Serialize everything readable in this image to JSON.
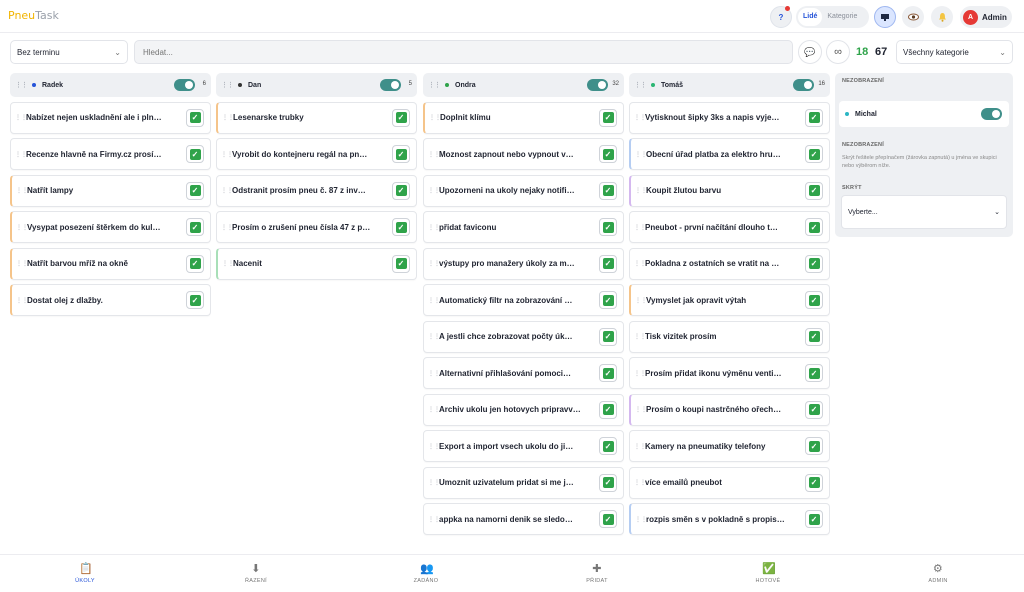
{
  "app": {
    "logo_a": "Pneu",
    "logo_b": "Task"
  },
  "header": {
    "help": "?",
    "seg": [
      "Lidé",
      "Kategorie"
    ],
    "user_initial": "A",
    "user_name": "Admin"
  },
  "toolbar": {
    "deadline": "Bez terminu",
    "search_placeholder": "Hledat...",
    "inf": "∞",
    "count_green": "18",
    "count_total": "67",
    "category": "Všechny kategorie"
  },
  "columns": [
    {
      "name": "Radek",
      "dot": "#2553d8",
      "count": "6",
      "cards": [
        {
          "t": "Nabízet nejen uskladnění ale i pln…",
          "b": "bl-n"
        },
        {
          "t": "Recenze hlavně na Firmy.cz prosí…",
          "b": "bl-n"
        },
        {
          "t": "Natřít lampy",
          "b": "bl-o"
        },
        {
          "t": "Vysypat posezení štěrkem do kul…",
          "b": "bl-o"
        },
        {
          "t": "Natřít barvou mříž na okně",
          "b": "bl-o"
        },
        {
          "t": "Dostat olej z dlažby.",
          "b": "bl-o"
        }
      ]
    },
    {
      "name": "Dan",
      "dot": "#333333",
      "count": "5",
      "cards": [
        {
          "t": "Lesenarske trubky",
          "b": "bl-o"
        },
        {
          "t": "Vyrobit do kontejneru regál na pn…",
          "b": "bl-n"
        },
        {
          "t": "Odstranit prosím pneu č. 87 z inv…",
          "b": "bl-n"
        },
        {
          "t": "Prosím o zrušení pneu čísla 47 z p…",
          "b": "bl-n"
        },
        {
          "t": "Nacenit",
          "b": "bl-g"
        }
      ]
    },
    {
      "name": "Ondra",
      "dot": "#2fa34a",
      "count": "32",
      "cards": [
        {
          "t": "Doplnit klímu",
          "b": "bl-o"
        },
        {
          "t": "Moznost zapnout nebo vypnout v…",
          "b": "bl-n"
        },
        {
          "t": "Upozorneni na ukoly nejaky notifi…",
          "b": "bl-n"
        },
        {
          "t": "přidat faviconu",
          "b": "bl-n"
        },
        {
          "t": "výstupy pro manažery úkoly za m…",
          "b": "bl-n"
        },
        {
          "t": "Automatický filtr na zobrazování …",
          "b": "bl-n"
        },
        {
          "t": "A jestli chce zobrazovat počty úk…",
          "b": "bl-n"
        },
        {
          "t": "Alternativní přihlašování pomoci…",
          "b": "bl-n"
        },
        {
          "t": "Archiv ukolu jen hotovych pripravv…",
          "b": "bl-n"
        },
        {
          "t": "Export a import vsech ukolu do ji…",
          "b": "bl-n"
        },
        {
          "t": "Umoznit uzivatelum pridat si me j…",
          "b": "bl-n"
        },
        {
          "t": "appka na namorni denik se sledo…",
          "b": "bl-n"
        }
      ]
    },
    {
      "name": "Tomáš",
      "dot": "#2bb673",
      "count": "16",
      "cards": [
        {
          "t": "Vytisknout šipky 3ks a napis vyje…",
          "b": "bl-n"
        },
        {
          "t": "Obecní úřad platba za elektro hru…",
          "b": "bl-b"
        },
        {
          "t": "Koupit žlutou barvu",
          "b": "bl-p"
        },
        {
          "t": "Pneubot - první načítání dlouho t…",
          "b": "bl-n"
        },
        {
          "t": "Pokladna z ostatních se vratit na …",
          "b": "bl-n"
        },
        {
          "t": "Vymyslet jak opravit výtah",
          "b": "bl-o"
        },
        {
          "t": "Tisk vizitek prosím",
          "b": "bl-n"
        },
        {
          "t": "Prosím přidat ikonu výměnu venti…",
          "b": "bl-n"
        },
        {
          "t": "Prosím o koupi nastrčného ořech…",
          "b": "bl-p"
        },
        {
          "t": "Kamery na pneumatiky telefony",
          "b": "bl-n"
        },
        {
          "t": "více emailů pneubot",
          "b": "bl-n"
        },
        {
          "t": "rozpis směn s v pokladně s propis…",
          "b": "bl-b"
        }
      ]
    }
  ],
  "right_panel": {
    "heading": "NEZOBRAZENÍ",
    "person": "Michal",
    "heading2": "NEZOBRAZENÍ",
    "desc": "Skrýt řešitele přepínačem (žárovka zapnutá) u jména ve skupici nebo výběrom níže.",
    "hide_label": "SKRÝT",
    "select": "Vyberte..."
  },
  "nav": [
    {
      "label": "ÚKOLY",
      "icon": "📋"
    },
    {
      "label": "ŘAZENÍ",
      "icon": "⬇"
    },
    {
      "label": "ZADÁNO",
      "icon": "👥"
    },
    {
      "label": "PŘIDAT",
      "icon": "✚"
    },
    {
      "label": "HOTOVÉ",
      "icon": "✅"
    },
    {
      "label": "ADMIN",
      "icon": "⚙"
    }
  ]
}
